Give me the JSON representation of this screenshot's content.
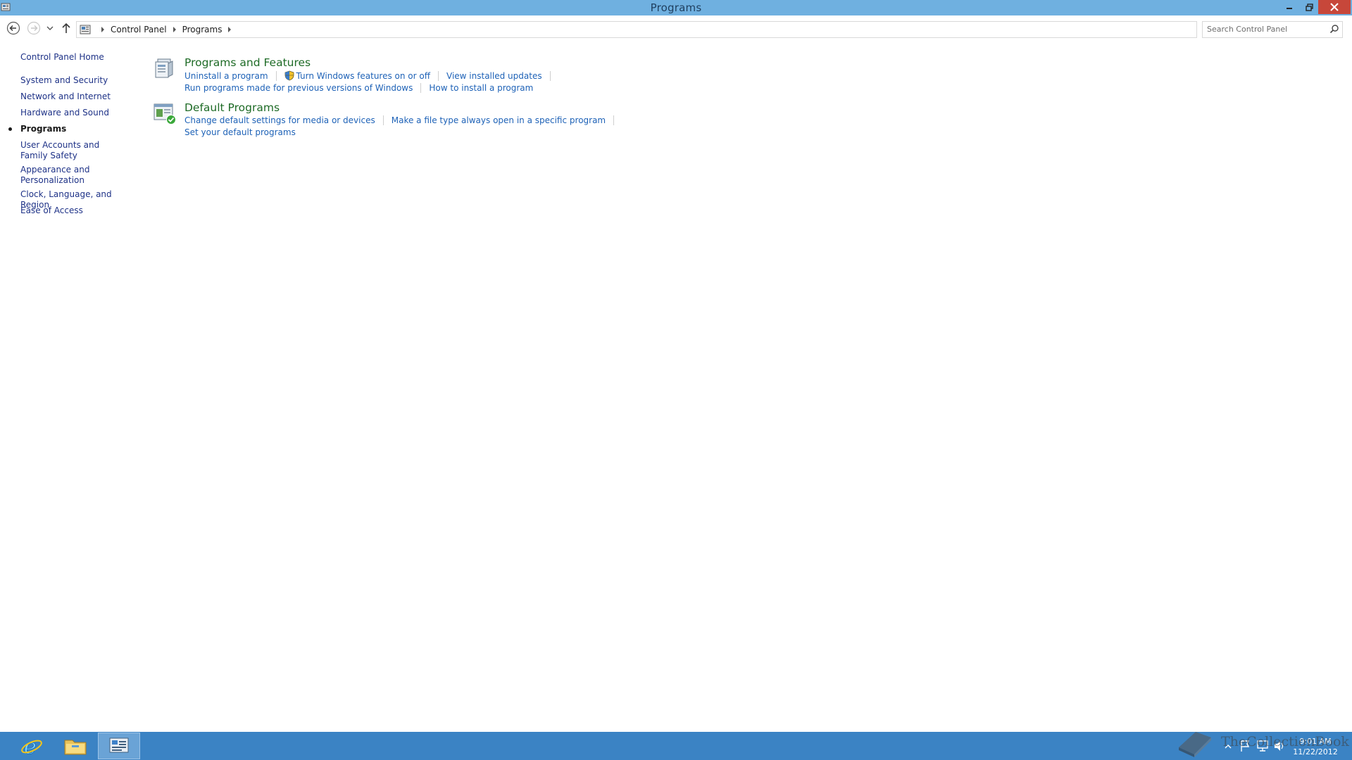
{
  "window": {
    "title": "Programs",
    "icon": "control-panel-icon"
  },
  "navigation": {
    "breadcrumbs": [
      "Control Panel",
      "Programs"
    ],
    "search_placeholder": "Search Control Panel"
  },
  "sidebar": {
    "items": [
      {
        "label": "Control Panel Home",
        "active": false
      },
      {
        "label": "System and Security",
        "active": false
      },
      {
        "label": "Network and Internet",
        "active": false
      },
      {
        "label": "Hardware and Sound",
        "active": false
      },
      {
        "label": "Programs",
        "active": true
      },
      {
        "label": "User Accounts and Family Safety",
        "active": false
      },
      {
        "label": "Appearance and Personalization",
        "active": false
      },
      {
        "label": "Clock, Language, and Region",
        "active": false
      },
      {
        "label": "Ease of Access",
        "active": false
      }
    ]
  },
  "categories": [
    {
      "title": "Programs and Features",
      "icon": "programs-features-icon",
      "tasks_row1": [
        "Uninstall a program",
        "Turn Windows features on or off",
        "View installed updates"
      ],
      "tasks_row2": [
        "Run programs made for previous versions of Windows",
        "How to install a program"
      ]
    },
    {
      "title": "Default Programs",
      "icon": "default-programs-icon",
      "tasks_row1": [
        "Change default settings for media or devices",
        "Make a file type always open in a specific program"
      ],
      "tasks_row2": [
        "Set your default programs"
      ]
    }
  ],
  "taskbar": {
    "apps": [
      "internet-explorer-icon",
      "file-explorer-icon",
      "control-panel-icon"
    ],
    "clock_time": "9:01 AM",
    "clock_date": "11/22/2012",
    "watermark_text": "TheCollectionBook"
  },
  "colors": {
    "titlebar": "#6fb0e0",
    "taskbar": "#3b83c4",
    "link": "#1e62b7",
    "category_title": "#1e6b26",
    "close_button": "#c7473a"
  }
}
